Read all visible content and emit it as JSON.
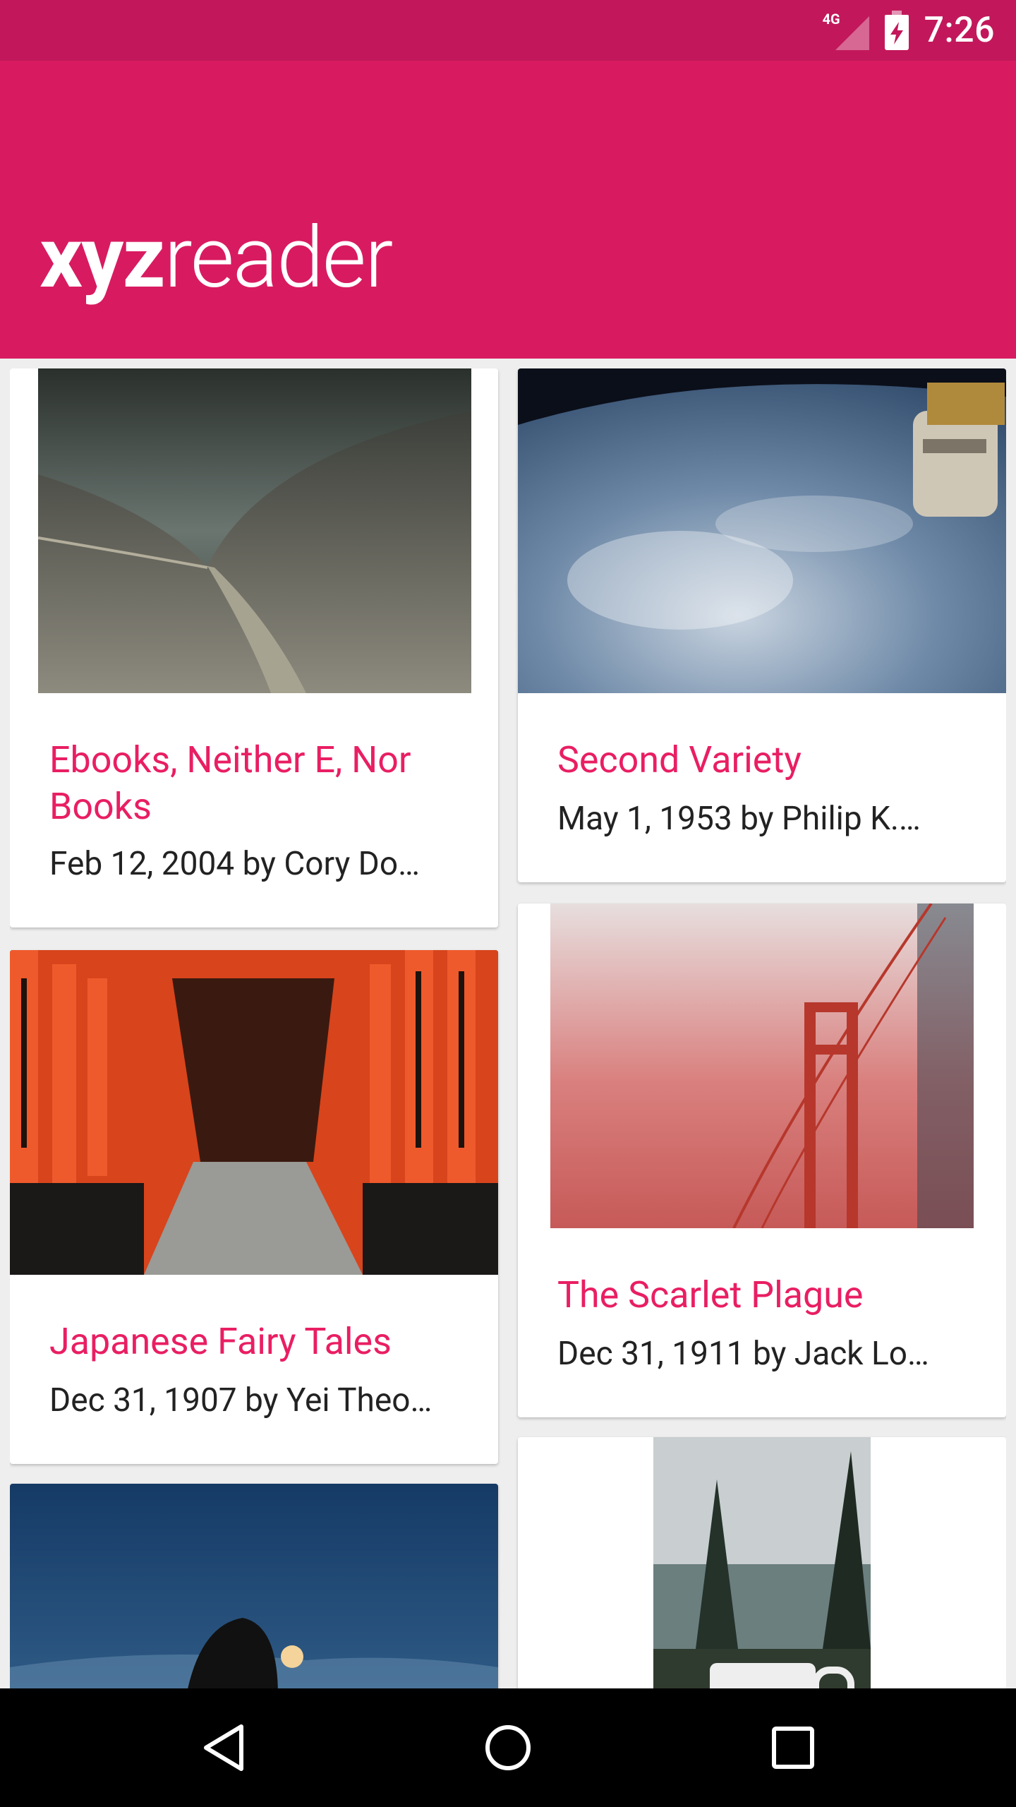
{
  "status_bar": {
    "network_label": "4G",
    "time": "7:26"
  },
  "app": {
    "logo_bold": "xyz",
    "logo_light": "reader"
  },
  "articles": [
    {
      "title": "Ebooks, Neither E, Nor Books",
      "subtitle": "Feb 12, 2004 by Cory Do…"
    },
    {
      "title": "Second Variety",
      "subtitle": "May 1, 1953 by Philip K.…"
    },
    {
      "title": "Japanese Fairy Tales",
      "subtitle": "Dec 31, 1907 by Yei Theo…"
    },
    {
      "title": "The Scarlet Plague",
      "subtitle": "Dec 31, 1911 by Jack Lo…"
    }
  ],
  "icons": {
    "back": "back-icon",
    "home": "home-icon",
    "recents": "recents-icon",
    "signal": "signal-icon",
    "battery": "battery-charging-icon"
  },
  "colors": {
    "primary": "#D81B60",
    "primary_dark": "#C2185B",
    "accent": "#E91E63"
  }
}
